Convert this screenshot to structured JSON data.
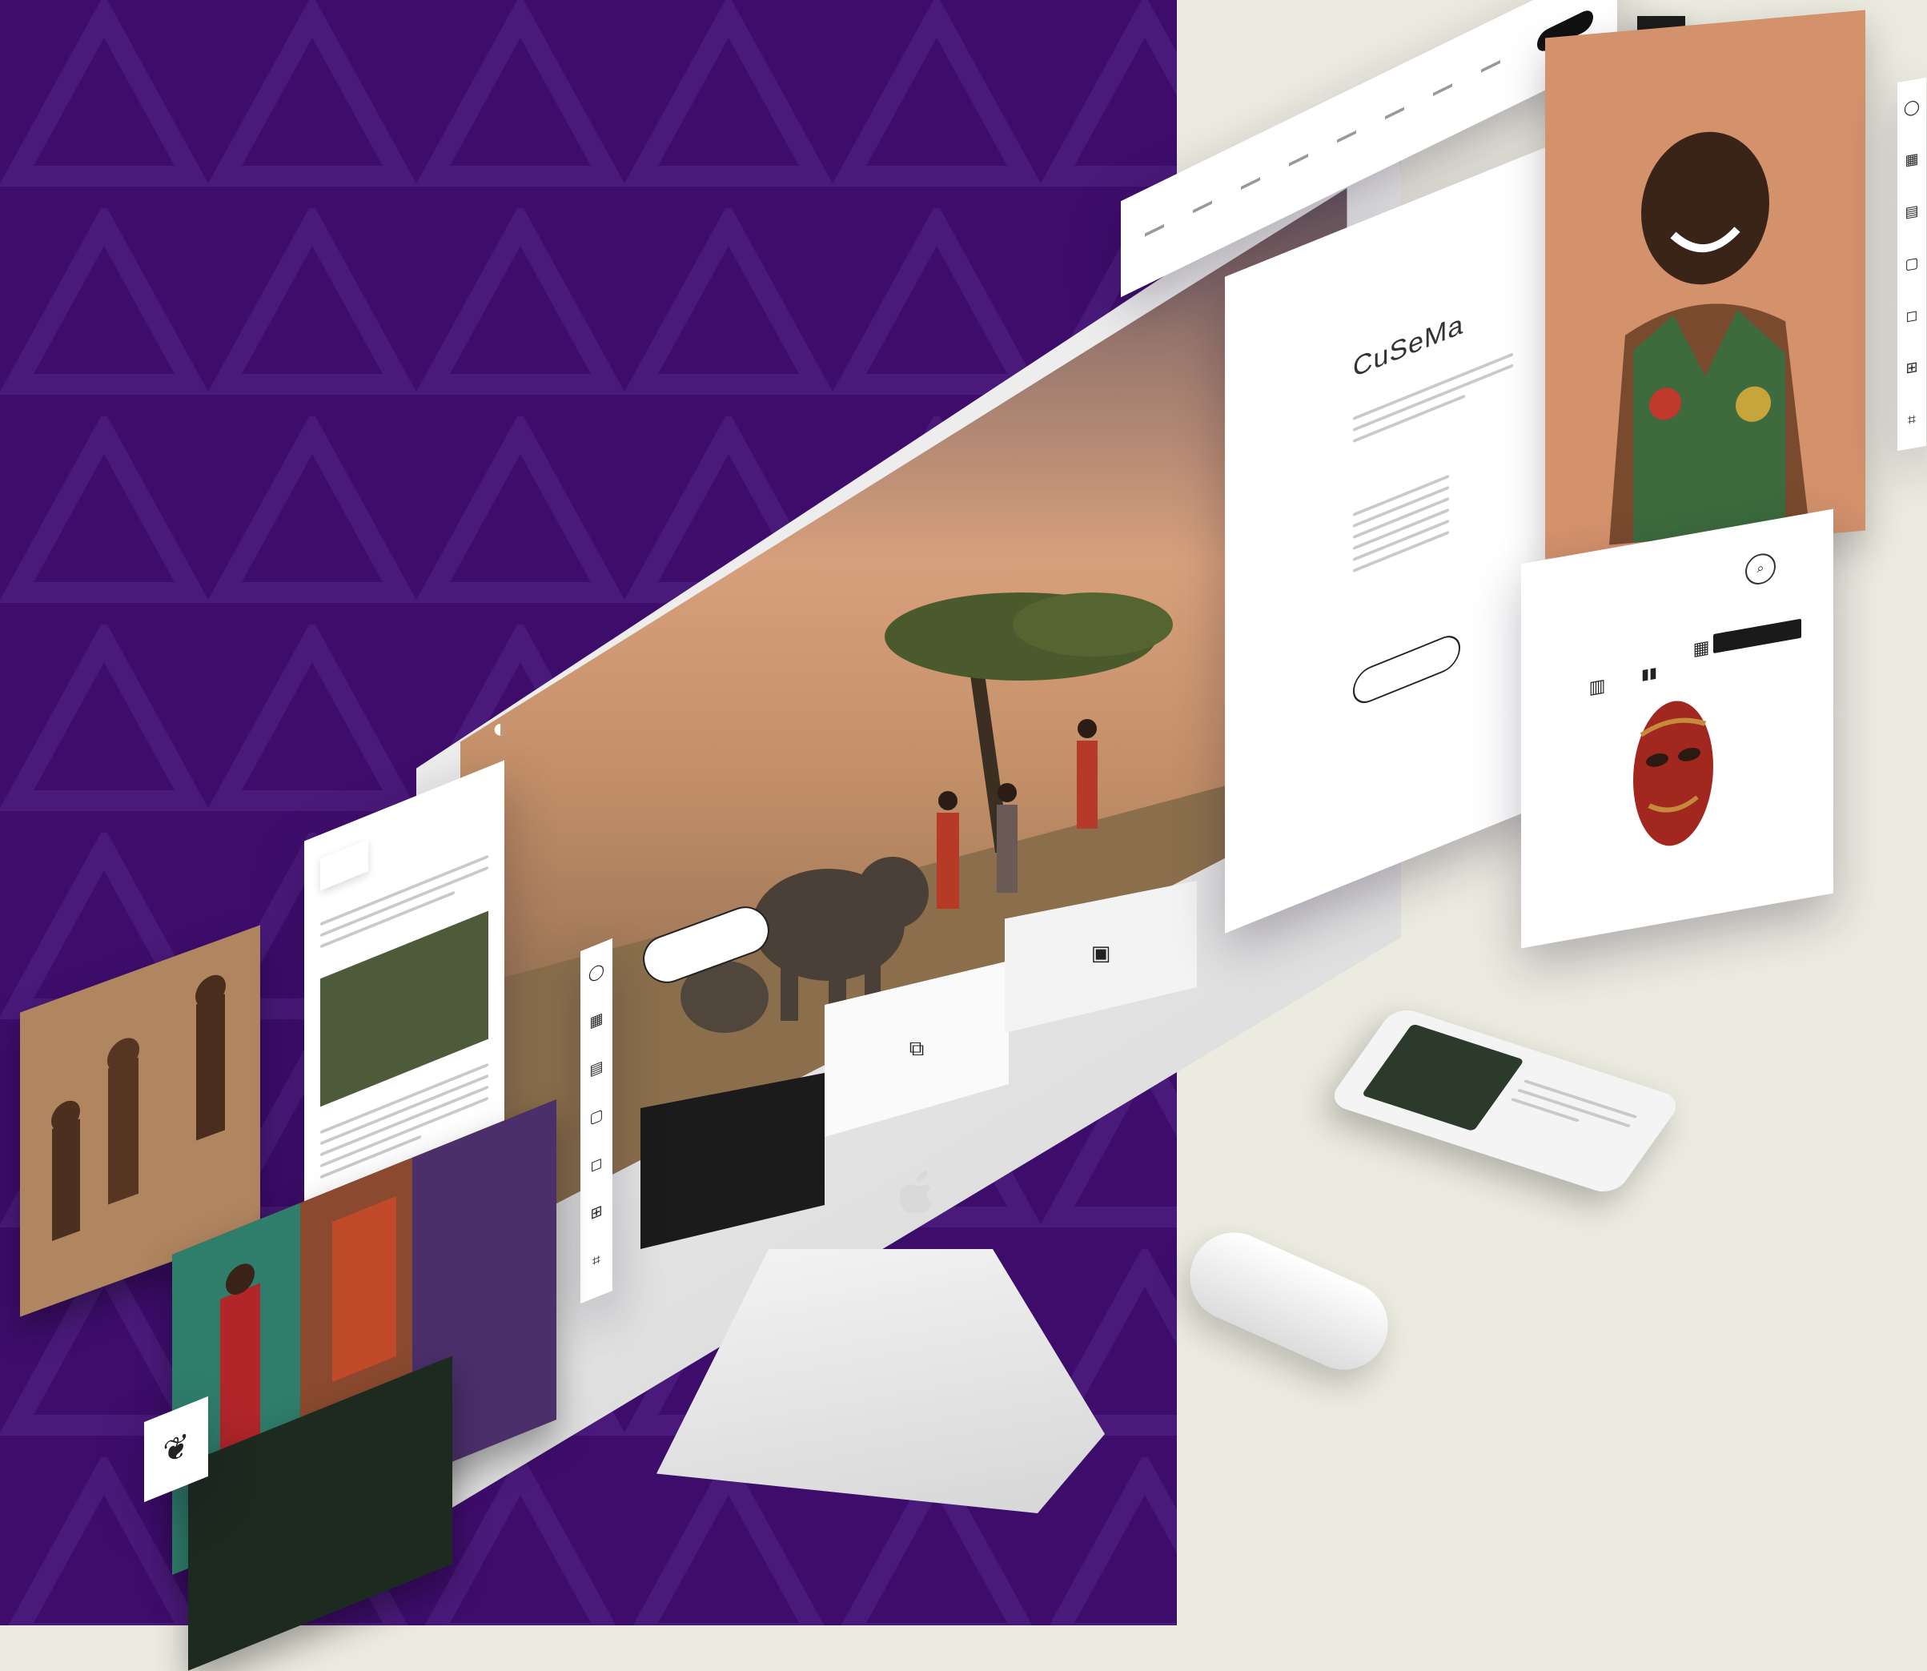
{
  "brand": {
    "name": ""
  },
  "hero": {
    "cta_label": "",
    "dark_tile_text": ""
  },
  "side_panel": {
    "heading": "CuSeMa"
  },
  "mask_card": {
    "heading": ""
  },
  "icons": {
    "vertical_toolbar": [
      "circle-icon",
      "calendar-icon",
      "grid-icon",
      "chat-icon",
      "bag-icon",
      "cart-icon",
      "crop-icon"
    ],
    "leaf": "leaf-icon",
    "logo": "logo-icon"
  },
  "colors": {
    "purple_bg": "#3e0d6c",
    "cream_bg": "#ecebe0",
    "accent_dark": "#1b1b1b"
  }
}
